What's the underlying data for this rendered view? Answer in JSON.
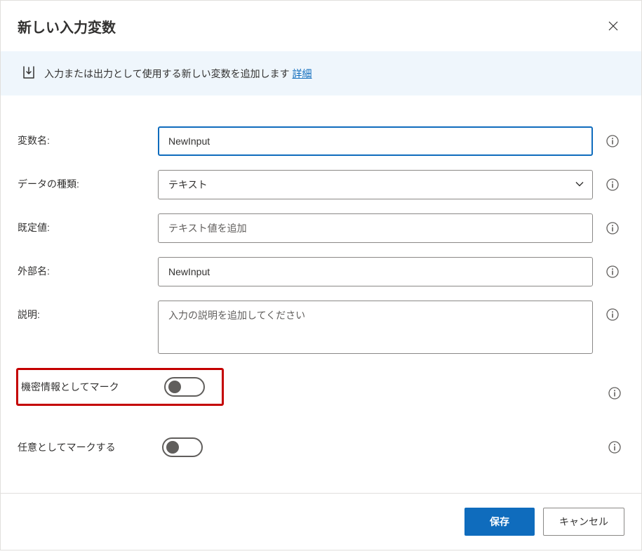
{
  "header": {
    "title": "新しい入力変数"
  },
  "banner": {
    "text": "入力または出力として使用する新しい変数を追加します",
    "link": "詳細"
  },
  "form": {
    "variable_name": {
      "label": "変数名:",
      "value": "NewInput"
    },
    "data_type": {
      "label": "データの種類:",
      "value": "テキスト"
    },
    "default_value": {
      "label": "既定値:",
      "placeholder": "テキスト値を追加"
    },
    "external_name": {
      "label": "外部名:",
      "value": "NewInput"
    },
    "description": {
      "label": "説明:",
      "placeholder": "入力の説明を追加してください"
    },
    "mark_sensitive": {
      "label": "機密情報としてマーク"
    },
    "mark_optional": {
      "label": "任意としてマークする"
    }
  },
  "footer": {
    "save": "保存",
    "cancel": "キャンセル"
  }
}
